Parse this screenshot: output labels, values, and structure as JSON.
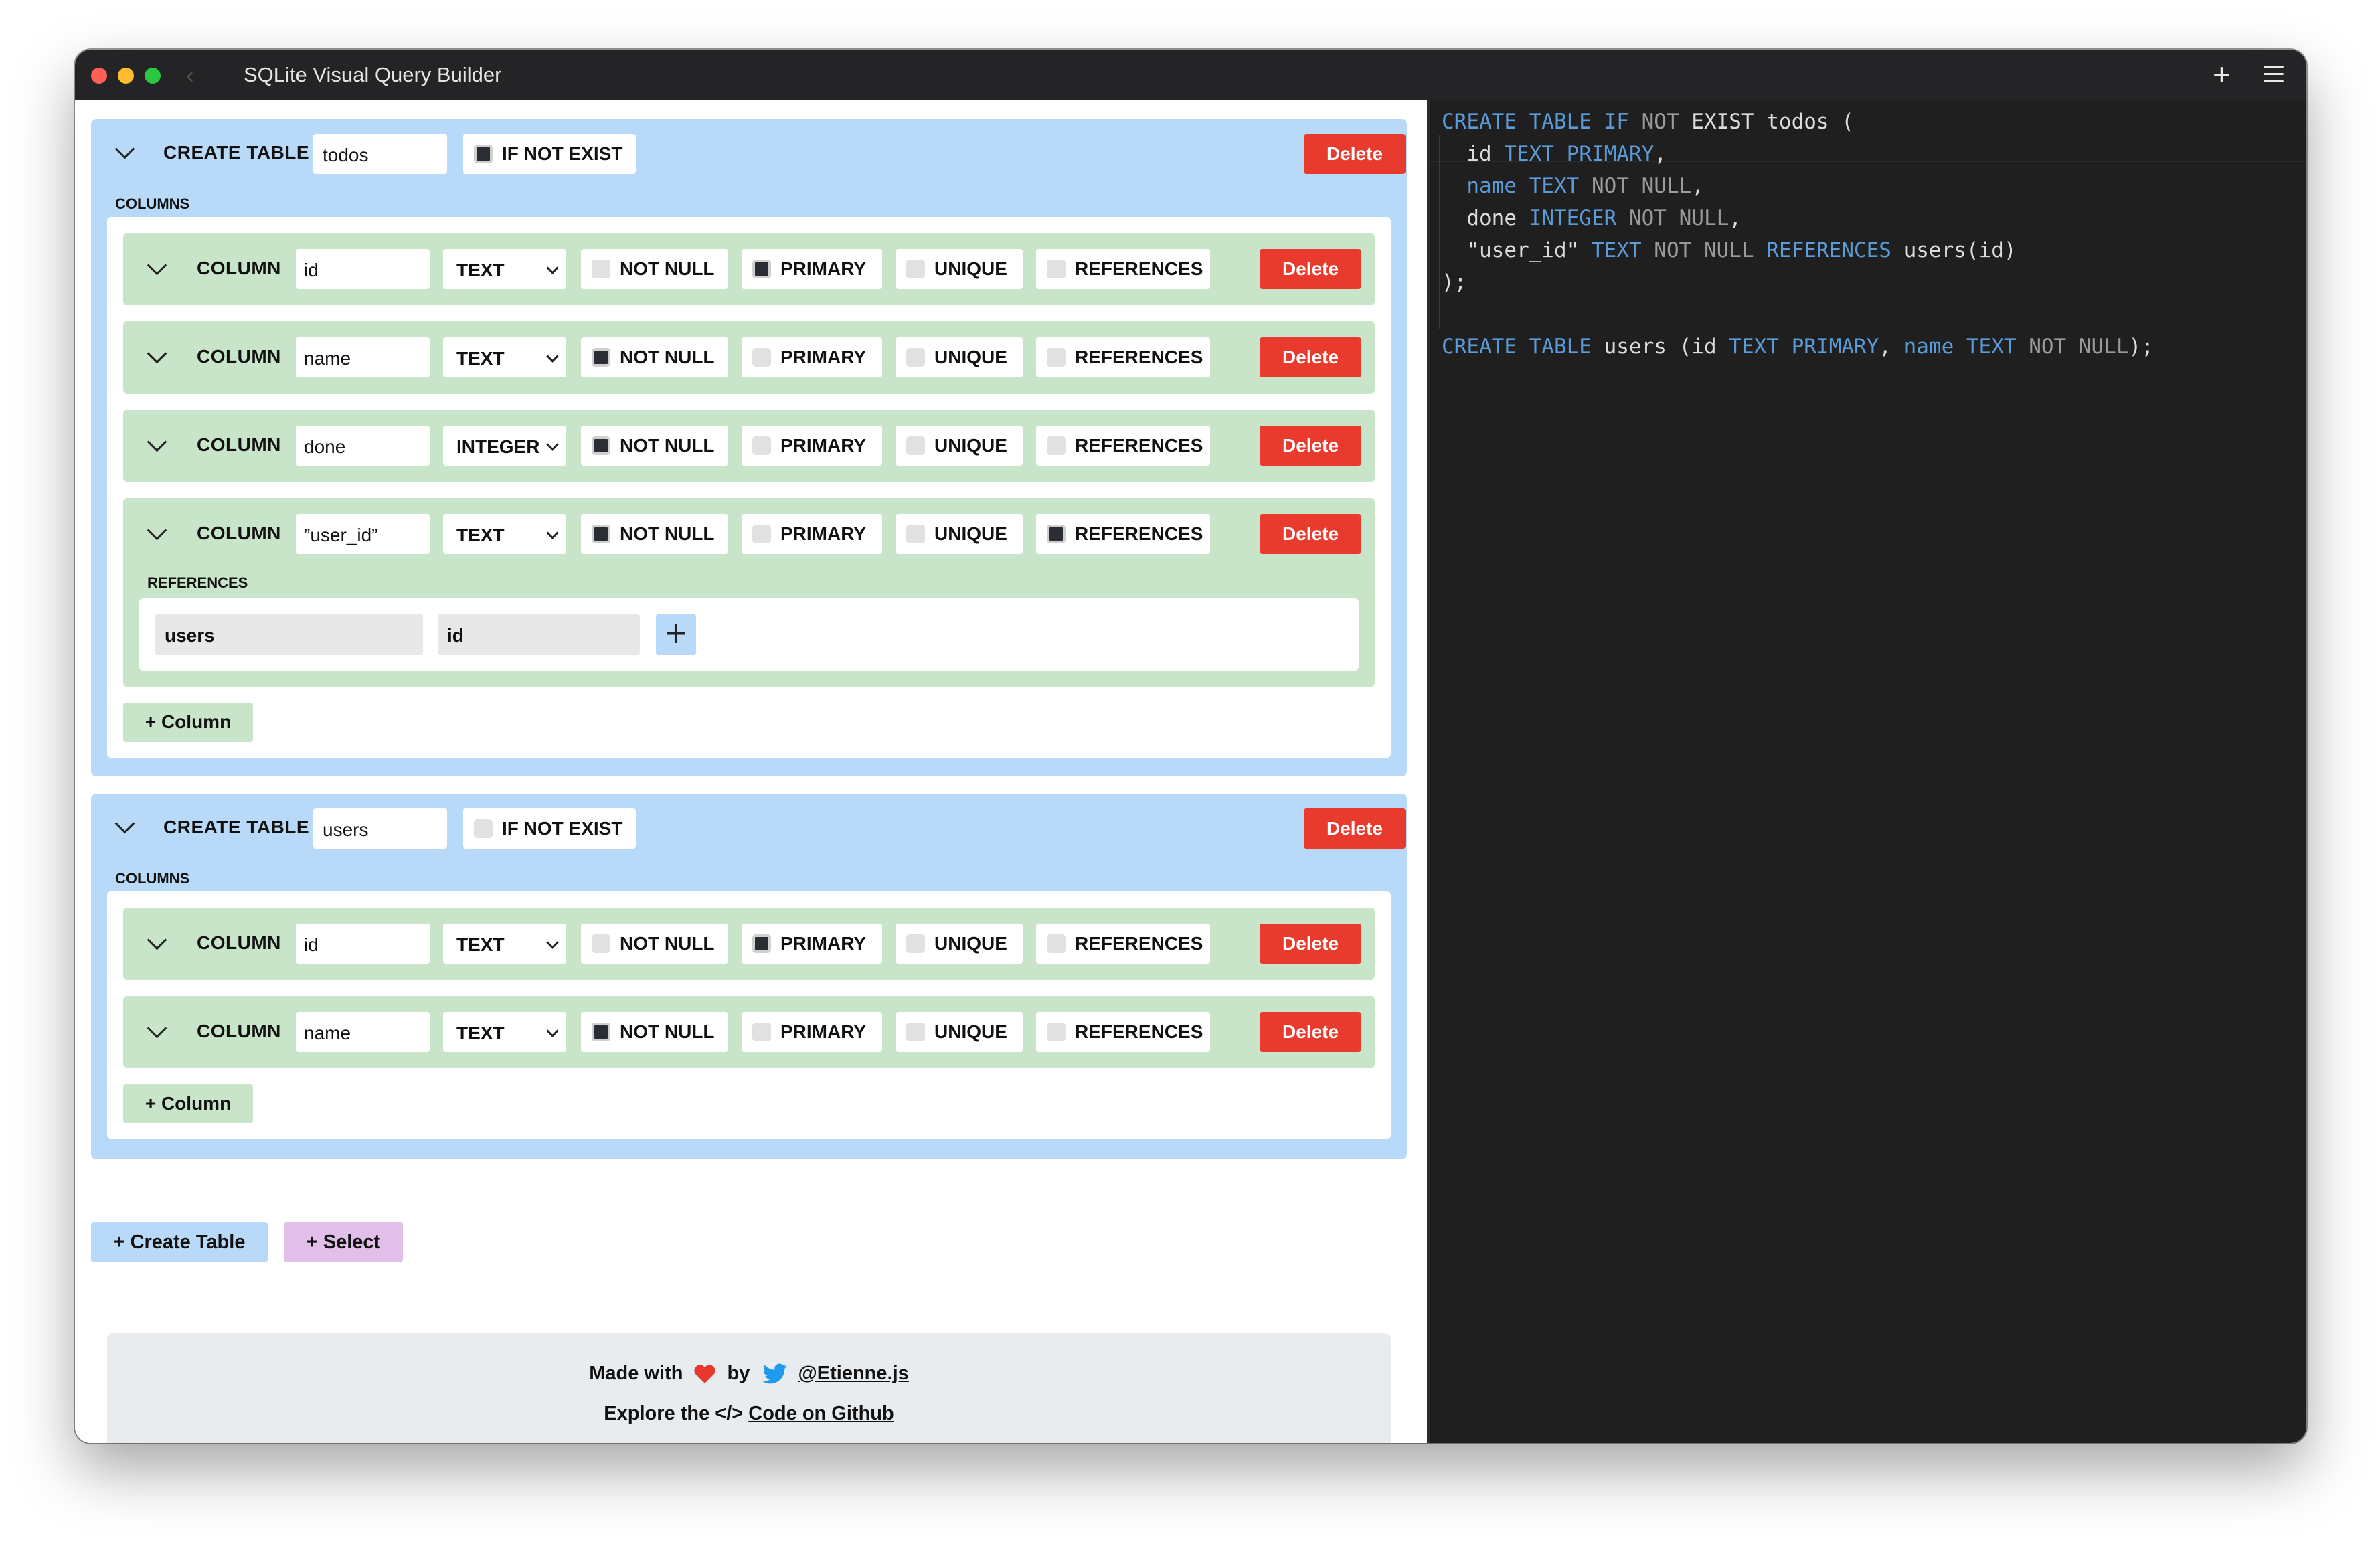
{
  "window": {
    "title": "SQLite Visual Query Builder"
  },
  "tables": [
    {
      "label": "CREATE TABLE",
      "name": "todos",
      "if_not_exist_label": "IF NOT EXIST",
      "if_not_exist": true,
      "delete_label": "Delete",
      "columns_label": "COLUMNS",
      "add_column_label": "+ Column",
      "columns": [
        {
          "label": "COLUMN",
          "name": "id",
          "type": "TEXT",
          "not_null": false,
          "primary": true,
          "unique": false,
          "references": false,
          "not_null_label": "NOT NULL",
          "primary_label": "PRIMARY",
          "unique_label": "UNIQUE",
          "references_label": "REFERENCES",
          "delete_label": "Delete"
        },
        {
          "label": "COLUMN",
          "name": "name",
          "type": "TEXT",
          "not_null": true,
          "primary": false,
          "unique": false,
          "references": false,
          "not_null_label": "NOT NULL",
          "primary_label": "PRIMARY",
          "unique_label": "UNIQUE",
          "references_label": "REFERENCES",
          "delete_label": "Delete"
        },
        {
          "label": "COLUMN",
          "name": "done",
          "type": "INTEGER",
          "not_null": true,
          "primary": false,
          "unique": false,
          "references": false,
          "not_null_label": "NOT NULL",
          "primary_label": "PRIMARY",
          "unique_label": "UNIQUE",
          "references_label": "REFERENCES",
          "delete_label": "Delete"
        },
        {
          "label": "COLUMN",
          "name": "”user_id”",
          "type": "TEXT",
          "not_null": true,
          "primary": false,
          "unique": false,
          "references": true,
          "not_null_label": "NOT NULL",
          "primary_label": "PRIMARY",
          "unique_label": "UNIQUE",
          "references_label": "REFERENCES",
          "delete_label": "Delete",
          "ref_section_label": "REFERENCES",
          "ref_table": "users",
          "ref_column": "id"
        }
      ]
    },
    {
      "label": "CREATE TABLE",
      "name": "users",
      "if_not_exist_label": "IF NOT EXIST",
      "if_not_exist": false,
      "delete_label": "Delete",
      "columns_label": "COLUMNS",
      "add_column_label": "+ Column",
      "columns": [
        {
          "label": "COLUMN",
          "name": "id",
          "type": "TEXT",
          "not_null": false,
          "primary": true,
          "unique": false,
          "references": false,
          "not_null_label": "NOT NULL",
          "primary_label": "PRIMARY",
          "unique_label": "UNIQUE",
          "references_label": "REFERENCES",
          "delete_label": "Delete"
        },
        {
          "label": "COLUMN",
          "name": "name",
          "type": "TEXT",
          "not_null": true,
          "primary": false,
          "unique": false,
          "references": false,
          "not_null_label": "NOT NULL",
          "primary_label": "PRIMARY",
          "unique_label": "UNIQUE",
          "references_label": "REFERENCES",
          "delete_label": "Delete"
        }
      ]
    }
  ],
  "actions": {
    "create_table_label": "+ Create Table",
    "select_label": "+ Select"
  },
  "footer": {
    "made_with": "Made with",
    "by": "by",
    "author": "@Etienne.js",
    "explore": "Explore the",
    "code_glyph": "</>",
    "code_link": "Code on Github"
  },
  "sql": {
    "lines": [
      [
        {
          "t": "CREATE TABLE IF ",
          "c": "kw"
        },
        {
          "t": "NOT ",
          "c": "n"
        },
        {
          "t": "EXIST todos ("
        }
      ],
      [
        {
          "t": "  id "
        },
        {
          "t": "TEXT PRIMARY",
          "c": "kw"
        },
        {
          "t": ","
        }
      ],
      [
        {
          "t": "  "
        },
        {
          "t": "name TEXT ",
          "c": "kw"
        },
        {
          "t": "NOT NULL",
          "c": "n"
        },
        {
          "t": ","
        }
      ],
      [
        {
          "t": "  done "
        },
        {
          "t": "INTEGER ",
          "c": "kw"
        },
        {
          "t": "NOT NULL",
          "c": "n"
        },
        {
          "t": ","
        }
      ],
      [
        {
          "t": "  \"user_id\" "
        },
        {
          "t": "TEXT ",
          "c": "kw"
        },
        {
          "t": "NOT NULL ",
          "c": "n"
        },
        {
          "t": "REFERENCES ",
          "c": "kw"
        },
        {
          "t": "users(id)"
        }
      ],
      [
        {
          "t": ");"
        }
      ],
      [
        {
          "t": ""
        }
      ],
      [
        {
          "t": "CREATE TABLE ",
          "c": "kw"
        },
        {
          "t": "users (id "
        },
        {
          "t": "TEXT PRIMARY",
          "c": "kw"
        },
        {
          "t": ", "
        },
        {
          "t": "name TEXT ",
          "c": "kw"
        },
        {
          "t": "NOT NULL",
          "c": "n"
        },
        {
          "t": ");"
        }
      ]
    ]
  },
  "colors": {
    "table_bg": "#b8d9f7",
    "column_bg": "#c9e5c9",
    "delete": "#e83a2d",
    "select_bg": "#e2bfe9",
    "editor_bg": "#1f1f1f"
  }
}
